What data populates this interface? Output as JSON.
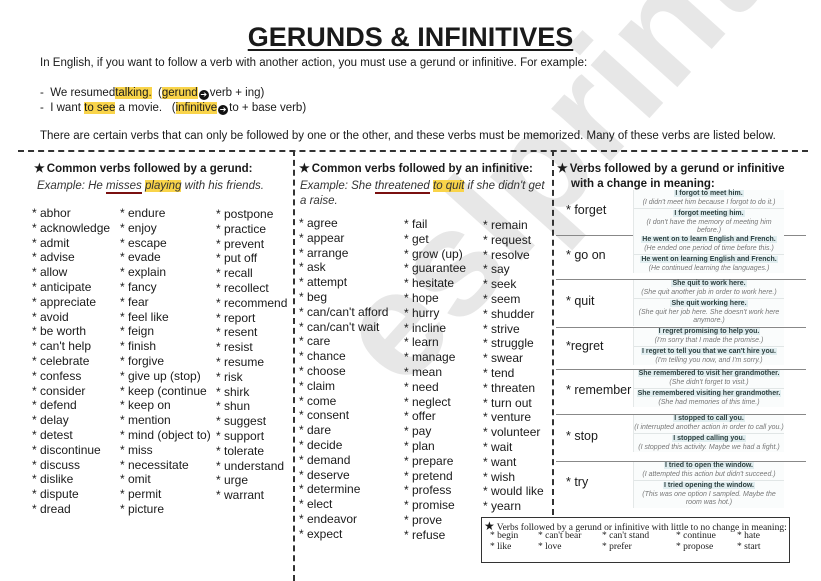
{
  "title": "GERUNDS & INFINITIVES",
  "intro": "In English, if you want to follow a verb with another action, you must use a gerund or infinitive. For example:",
  "examples": [
    {
      "dash": "-",
      "pre": "We resumed",
      "highlight": "talking.",
      "paren_open": "(",
      "label": "gerund",
      "rule": "verb + ing)"
    },
    {
      "dash": "-",
      "pre": "I want",
      "highlight": "to see",
      "post": "a movie.",
      "paren_open": "(",
      "label": "infinitive",
      "rule": "to + base verb)"
    }
  ],
  "note": "There are certain verbs that can only be followed by one or the other, and these verbs must be memorized. Many of these verbs are listed below.",
  "gerund_section": {
    "heading": "Common verbs followed by a gerund:",
    "example": {
      "pre": "Example: He ",
      "underlined": "misses",
      "highlight": "playing",
      "post": " with his friends."
    },
    "columns": [
      [
        "* abhor",
        "* acknowledge",
        "* admit",
        "* advise",
        "* allow",
        "* anticipate",
        "* appreciate",
        "* avoid",
        "* be worth",
        "* can't help",
        "* celebrate",
        "* confess",
        "* consider",
        "* defend",
        "* delay",
        "* detest",
        "* discontinue",
        "* discuss",
        "* dislike",
        "* dispute",
        "* dread"
      ],
      [
        "* endure",
        "* enjoy",
        "* escape",
        "* evade",
        "* explain",
        "* fancy",
        "* fear",
        "* feel like",
        "* feign",
        "* finish",
        "* forgive",
        "* give up (stop)",
        "* keep (continue",
        "* keep on",
        "* mention",
        "* mind (object to)",
        "* miss",
        "* necessitate",
        "* omit",
        "* permit",
        "* picture"
      ],
      [
        "* postpone",
        "* practice",
        "* prevent",
        "* put off",
        "* recall",
        "* recollect",
        "* recommend",
        "* report",
        "* resent",
        "* resist",
        "* resume",
        "* risk",
        "* shirk",
        "* shun",
        "* suggest",
        "* support",
        "* tolerate",
        "* understand",
        "* urge",
        "* warrant"
      ]
    ]
  },
  "infinitive_section": {
    "heading": "Common verbs followed by an infinitive:",
    "example": {
      "pre": "Example: She ",
      "underlined": "threatened",
      "highlight": "to quit",
      "post": " if she didn't get",
      "line2": "a raise."
    },
    "columns": [
      [
        "* agree",
        "* appear",
        "* arrange",
        "* ask",
        "* attempt",
        "* beg",
        "* can/can't afford",
        "* can/can't wait",
        "* care",
        "* chance",
        "* choose",
        "* claim",
        "* come",
        "* consent",
        "* dare",
        "* decide",
        "* demand",
        "* deserve",
        "* determine",
        "* elect",
        "* endeavor",
        "* expect"
      ],
      [
        "* fail",
        "* get",
        "* grow (up)",
        "* guarantee",
        "* hesitate",
        "* hope",
        "* hurry",
        "* incline",
        "* learn",
        "* manage",
        "* mean",
        "* need",
        "* neglect",
        "* offer",
        "* pay",
        "* plan",
        "* prepare",
        "* pretend",
        "* profess",
        "* promise",
        "* prove",
        "* refuse"
      ],
      [
        "* remain",
        "* request",
        "* resolve",
        "* say",
        "* seek",
        "* seem",
        "* shudder",
        "* strive",
        "* struggle",
        "* swear",
        "* tend",
        "* threaten",
        "* turn out",
        "* venture",
        "* volunteer",
        "* wait",
        "* want",
        "* wish",
        "* would like",
        "* yearn"
      ]
    ]
  },
  "meaning_section": {
    "heading_line1": "Verbs followed by a gerund or infinitive",
    "heading_line2": "with a change in meaning:",
    "verbs": [
      {
        "verb": "* forget",
        "pairs": [
          {
            "sentence": "I forgot to meet him.",
            "explanation": "(I didn't meet him because I forgot to do it.)"
          },
          {
            "sentence": "I forgot meeting him.",
            "explanation": "(I don't have the memory of meeting him before.)"
          }
        ]
      },
      {
        "verb": "* go on",
        "pairs": [
          {
            "sentence": "He went on to learn English and French.",
            "explanation": "(He ended one period of time before this.)"
          },
          {
            "sentence": "He went on learning English and French.",
            "explanation": "(He continued learning the languages.)"
          }
        ]
      },
      {
        "verb": "* quit",
        "pairs": [
          {
            "sentence": "She quit to work here.",
            "explanation": "(She quit another job in order to work here.)"
          },
          {
            "sentence": "She quit working here.",
            "explanation": "(She quit her job here. She doesn't work here anymore.)"
          }
        ]
      },
      {
        "verb": "*regret",
        "pairs": [
          {
            "sentence": "I regret promising to help you.",
            "explanation": "(I'm sorry that I made the promise.)"
          },
          {
            "sentence": "I regret to tell you that we can't hire you.",
            "explanation": "(I'm telling you now, and I'm sorry.)"
          }
        ]
      },
      {
        "verb": "* remember",
        "pairs": [
          {
            "sentence": "She remembered to visit her grandmother.",
            "explanation": "(She didn't forget to visit.)"
          },
          {
            "sentence": "She remembered visiting her grandmother.",
            "explanation": "(She had memories of this time.)"
          }
        ]
      },
      {
        "verb": "* stop",
        "pairs": [
          {
            "sentence": "I stopped to call you.",
            "explanation": "(I interrupted another action in order to call you.)"
          },
          {
            "sentence": "I stopped calling you.",
            "explanation": "(I stopped this activity. Maybe we had a fight.)"
          }
        ]
      },
      {
        "verb": "* try",
        "pairs": [
          {
            "sentence": "I tried to open the window.",
            "explanation": "(I attempted this action but didn't succeed.)"
          },
          {
            "sentence": "I tried opening the window.",
            "explanation": "(This was one option I sampled. Maybe the room was hot.)"
          }
        ]
      }
    ]
  },
  "no_change_section": {
    "heading": "Verbs followed by a gerund or infinitive with little to no change in meaning:",
    "row1": [
      "* begin",
      "* can't bear",
      "* can't stand",
      "* continue",
      "* hate"
    ],
    "row2": [
      "* like",
      "* love",
      "* prefer",
      "* propose",
      "* start"
    ]
  },
  "watermark": "eslprintables.com"
}
